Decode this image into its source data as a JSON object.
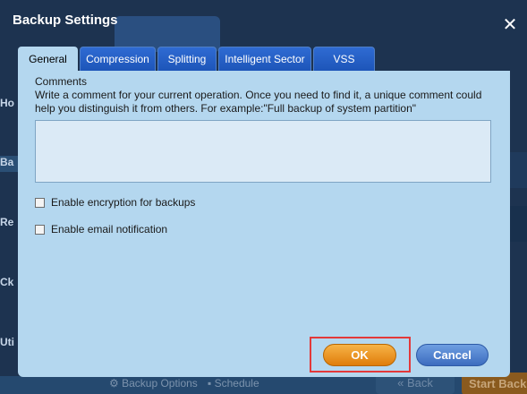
{
  "background": {
    "sidebar_items": [
      "Ho",
      "Ba",
      "Re",
      "Ck",
      "Uti"
    ],
    "bottom_links": [
      "Backup Options",
      "Schedule"
    ],
    "back_label": "Back",
    "start_label": "Start Back"
  },
  "dialog": {
    "title": "Backup Settings",
    "close_glyph": "✕",
    "tabs": [
      {
        "label": "General",
        "active": true
      },
      {
        "label": "Compression",
        "active": false
      },
      {
        "label": "Splitting",
        "active": false
      },
      {
        "label": "Intelligent Sector",
        "active": false
      },
      {
        "label": "VSS",
        "active": false
      }
    ],
    "general": {
      "comments_label": "Comments",
      "comments_description": "Write a comment for your current operation. Once you need to find it, a unique comment could help you distinguish it from others. For example:\"Full backup of system partition\"",
      "comment_value": "",
      "encryption_label": "Enable encryption for backups",
      "encryption_checked": false,
      "email_label": "Enable email notification",
      "email_checked": false
    },
    "ok_label": "OK",
    "cancel_label": "Cancel"
  },
  "colors": {
    "window_bg": "#1d3350",
    "panel_bg": "#b4d7ef",
    "tab_bg": "#1d55b9",
    "ok_button": "#e07d0b",
    "cancel_button": "#3c6cbf",
    "highlight": "#e3393a"
  }
}
